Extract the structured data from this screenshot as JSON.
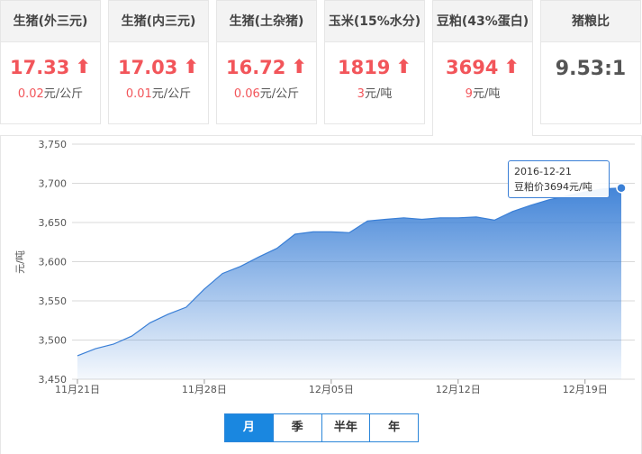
{
  "cards": [
    {
      "title": "生猪(外三元)",
      "price": "17.33",
      "arrow": "⬆",
      "change": "0.02",
      "unit": "元/公斤"
    },
    {
      "title": "生猪(内三元)",
      "price": "17.03",
      "arrow": "⬆",
      "change": "0.01",
      "unit": "元/公斤"
    },
    {
      "title": "生猪(土杂猪)",
      "price": "16.72",
      "arrow": "⬆",
      "change": "0.06",
      "unit": "元/公斤"
    },
    {
      "title": "玉米(15%水分)",
      "price": "1819",
      "arrow": "⬆",
      "change": "3",
      "unit": "元/吨"
    },
    {
      "title": "豆粕(43%蛋白)",
      "price": "3694",
      "arrow": "⬆",
      "change": "9",
      "unit": "元/吨"
    },
    {
      "title": "猪粮比",
      "ratio": "9.53:1"
    }
  ],
  "tooltip": {
    "date": "2016-12-21",
    "label": "豆粕价3694元/吨"
  },
  "tabs": [
    "月",
    "季",
    "半年",
    "年"
  ],
  "colors": {
    "up": "#f2555a",
    "line": "#3a7fd6",
    "tab_active": "#1a87e0"
  },
  "chart_data": {
    "type": "area",
    "title": "",
    "xlabel": "",
    "ylabel": "元/吨",
    "ylim": [
      3450,
      3750
    ],
    "yticks": [
      3450,
      3500,
      3550,
      3600,
      3650,
      3700,
      3750
    ],
    "ytick_labels": [
      "3,450",
      "3,500",
      "3,550",
      "3,600",
      "3,650",
      "3,700",
      "3,750"
    ],
    "x": [
      0,
      1,
      2,
      3,
      4,
      5,
      6,
      7,
      8,
      9,
      10,
      11,
      12,
      13,
      14,
      15,
      16,
      17,
      18,
      19,
      20,
      21,
      22,
      23,
      24,
      25,
      26,
      27,
      28,
      29,
      30
    ],
    "xtick_indices": [
      0,
      7,
      14,
      21,
      28
    ],
    "xtick_labels": [
      "11月21日",
      "11月28日",
      "12月05日",
      "12月12日",
      "12月19日"
    ],
    "series": [
      {
        "values": [
          3480,
          3489,
          3495,
          3505,
          3522,
          3533,
          3542,
          3565,
          3585,
          3594,
          3606,
          3617,
          3635,
          3638,
          3638,
          3637,
          3652,
          3654,
          3656,
          3654,
          3656,
          3656,
          3657,
          3653,
          3664,
          3672,
          3679,
          3684,
          3689,
          3693,
          3694
        ]
      }
    ],
    "grid": true,
    "highlight_index": 30
  }
}
